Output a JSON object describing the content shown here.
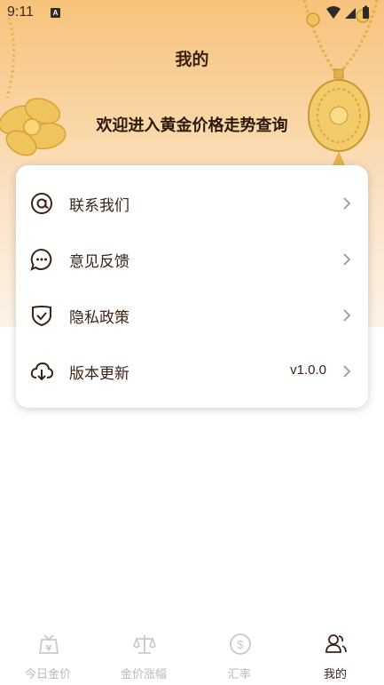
{
  "status_bar": {
    "time": "9:11",
    "notification_badge": "A"
  },
  "header": {
    "title": "我的",
    "welcome": "欢迎进入黄金价格走势查询"
  },
  "menu": {
    "items": [
      {
        "label": "联系我们",
        "icon": "at-sign-icon"
      },
      {
        "label": "意见反馈",
        "icon": "chat-bubble-icon"
      },
      {
        "label": "隐私政策",
        "icon": "shield-check-icon"
      },
      {
        "label": "版本更新",
        "icon": "cloud-download-icon",
        "value": "v1.0.0"
      }
    ]
  },
  "tabbar": {
    "tabs": [
      {
        "label": "今日金价",
        "icon": "gold-price-icon",
        "active": false
      },
      {
        "label": "金价涨幅",
        "icon": "balance-scale-icon",
        "active": false
      },
      {
        "label": "汇率",
        "icon": "dollar-coin-icon",
        "active": false
      },
      {
        "label": "我的",
        "icon": "user-group-icon",
        "active": true
      }
    ]
  },
  "colors": {
    "accent": "#3a2416",
    "inactive": "#b9b9b9",
    "gold_top": "#f7c37c",
    "gold_bottom": "#fdf3e8"
  }
}
